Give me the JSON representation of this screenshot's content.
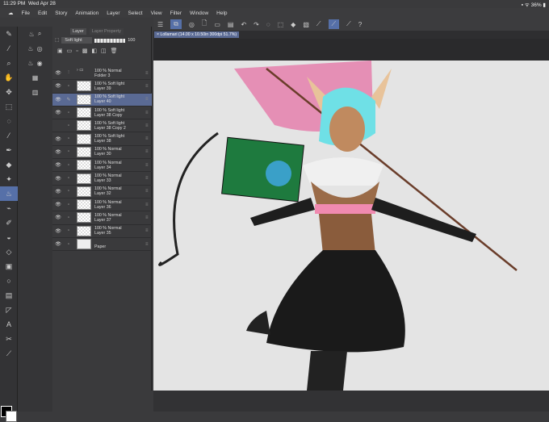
{
  "status": {
    "time": "11:29 PM",
    "date": "Wed Apr 28",
    "battery": "36%"
  },
  "menu": [
    "File",
    "Edit",
    "Story",
    "Animation",
    "Layer",
    "Select",
    "View",
    "Filter",
    "Window",
    "Help"
  ],
  "document_tab": "Lollamari (14.00 x 10.50in 300dpi 51.7%)",
  "layer_panel": {
    "tabs": [
      "Layer",
      "Layer Property"
    ],
    "blend_mode": "Soft light",
    "opacity": "100",
    "layers": [
      {
        "mode": "100 % Normal",
        "name": "Folder 3",
        "visible": true,
        "folder": true
      },
      {
        "mode": "100 % Soft light",
        "name": "Layer 39",
        "visible": true
      },
      {
        "mode": "100 % Soft light",
        "name": "Layer 40",
        "visible": true,
        "selected": true
      },
      {
        "mode": "100 % Soft light",
        "name": "Layer 38 Copy",
        "visible": true
      },
      {
        "mode": "100 % Soft light",
        "name": "Layer 38 Copy 2",
        "visible": false
      },
      {
        "mode": "100 % Soft light",
        "name": "Layer 38",
        "visible": true
      },
      {
        "mode": "100 % Normal",
        "name": "Layer 30",
        "visible": true
      },
      {
        "mode": "100 % Normal",
        "name": "Layer 34",
        "visible": true
      },
      {
        "mode": "100 % Normal",
        "name": "Layer 33",
        "visible": true
      },
      {
        "mode": "100 % Normal",
        "name": "Layer 32",
        "visible": true
      },
      {
        "mode": "100 % Normal",
        "name": "Layer 36",
        "visible": true
      },
      {
        "mode": "100 % Normal",
        "name": "Layer 37",
        "visible": true
      },
      {
        "mode": "100 % Normal",
        "name": "Layer 35",
        "visible": true
      },
      {
        "mode": "",
        "name": "Paper",
        "visible": true,
        "paper": true
      }
    ]
  },
  "colors": {
    "accent": "#5670a8",
    "foreground": "#000000",
    "background": "#ffffff"
  }
}
